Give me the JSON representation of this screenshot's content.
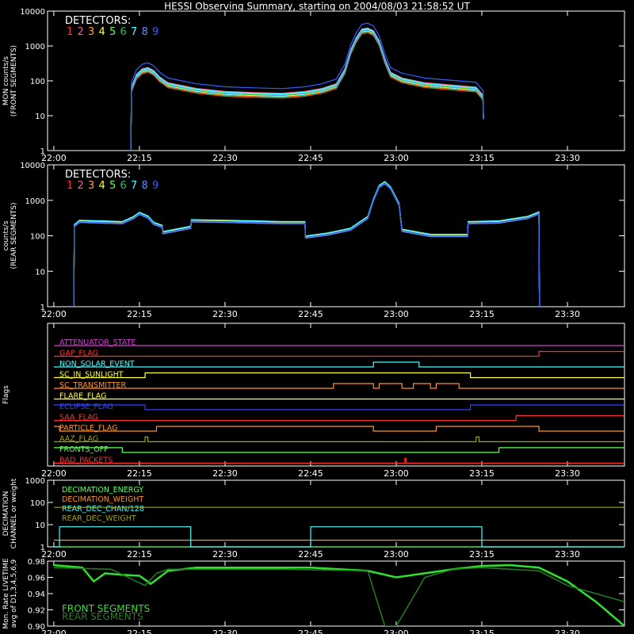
{
  "title": "HESSI Observing Summary, starting on 2004/08/03 21:58:52 UT",
  "time_labels": [
    "22:00",
    "22:15",
    "22:30",
    "22:45",
    "23:00",
    "23:15",
    "23:30"
  ],
  "colors": {
    "det": [
      "#ff3030",
      "#ff5aa0",
      "#ffa030",
      "#ffff40",
      "#60ff60",
      "#30c060",
      "#40ffff",
      "#6090ff",
      "#3060ff"
    ],
    "axis": "#ffffff",
    "background": "#000000"
  },
  "chart_data": [
    {
      "type": "line",
      "panel": "front",
      "ylabel": "MON counts/s (FRONT SEGMENTS)",
      "yscale": "log",
      "ylim": [
        1,
        10000
      ],
      "ytick_labels": [
        "1",
        "10",
        "100",
        "1000",
        "10000"
      ],
      "legend_title": "DETECTORS:",
      "legend_labels": [
        "1",
        "2",
        "3",
        "4",
        "5",
        "6",
        "7",
        "8",
        "9"
      ],
      "x_minutes": [
        13.5,
        13.6,
        14.5,
        15.5,
        16.5,
        17.5,
        18.5,
        20,
        25,
        30,
        35,
        40,
        44,
        47,
        49.5,
        51,
        52,
        53,
        54,
        55,
        56,
        57,
        58,
        59,
        61,
        65,
        74,
        75.2,
        75.3
      ],
      "y": [
        1,
        60,
        140,
        200,
        220,
        180,
        120,
        80,
        55,
        45,
        42,
        40,
        45,
        55,
        75,
        200,
        700,
        1600,
        2800,
        3000,
        2500,
        1300,
        400,
        160,
        110,
        80,
        60,
        35,
        8
      ],
      "detector_scale": [
        0.8,
        1.1,
        1.0,
        0.9,
        1.0,
        0.85,
        1.05,
        0.95,
        1.5
      ]
    },
    {
      "type": "line",
      "panel": "rear",
      "ylabel": "counts/s (REAR SEGMENTS)",
      "yscale": "log",
      "ylim": [
        1,
        10000
      ],
      "ytick_labels": [
        "1",
        "10",
        "100",
        "1000",
        "10000"
      ],
      "legend_title": "DETECTORS:",
      "legend_labels": [
        "1",
        "2",
        "3",
        "4",
        "5",
        "6",
        "7",
        "8",
        "9"
      ],
      "x_minutes": [
        3.5,
        3.6,
        4.5,
        8,
        12,
        14,
        15,
        16.5,
        17.5,
        19,
        19.1,
        24,
        24.1,
        30,
        35,
        40,
        44,
        44.1,
        48,
        52,
        55,
        56,
        57,
        58,
        59,
        60.5,
        61,
        66,
        72.5,
        72.6,
        78,
        83,
        85,
        85.1
      ],
      "y": [
        1,
        190,
        250,
        240,
        230,
        320,
        420,
        330,
        220,
        180,
        120,
        170,
        260,
        250,
        240,
        230,
        230,
        90,
        110,
        150,
        320,
        1000,
        2400,
        3100,
        2200,
        750,
        140,
        100,
        100,
        230,
        240,
        320,
        430,
        1
      ],
      "detector_scale": [
        1.0,
        1.0,
        0.95,
        1.05,
        1.0,
        1.0,
        1.1,
        0.95,
        1.0
      ]
    },
    {
      "type": "step",
      "panel": "flags",
      "ylabel": "Flags",
      "series": [
        {
          "name": "ATTENUATOR_STATE",
          "color": "#d040d0",
          "x": [
            0,
            100
          ],
          "y": [
            0,
            0
          ]
        },
        {
          "name": "GAP_FLAG",
          "color": "#ff3030",
          "x": [
            0,
            85,
            85,
            100
          ],
          "y": [
            0,
            0,
            1,
            1
          ]
        },
        {
          "name": "NON_SOLAR_EVENT",
          "color": "#40ffff",
          "x": [
            0,
            56,
            56,
            64,
            64,
            100
          ],
          "y": [
            0,
            0,
            1,
            1,
            0,
            0
          ]
        },
        {
          "name": "SC_IN_SUNLIGHT",
          "color": "#ffff40",
          "x": [
            0,
            16,
            16,
            73,
            73,
            100
          ],
          "y": [
            0,
            0,
            1,
            1,
            0,
            0
          ]
        },
        {
          "name": "SC_TRANSMITTER",
          "color": "#ff9030",
          "x": [
            0,
            49,
            49,
            56,
            56,
            57,
            57,
            61,
            61,
            63,
            63,
            66,
            66,
            67,
            67,
            71,
            71,
            100
          ],
          "y": [
            0,
            0,
            1,
            1,
            0,
            0,
            1,
            1,
            0,
            0,
            1,
            1,
            0,
            0,
            1,
            1,
            0,
            0
          ]
        },
        {
          "name": "FLARE_FLAG",
          "color": "#ffff40",
          "x": [
            0,
            100
          ],
          "y": [
            0,
            0
          ]
        },
        {
          "name": "ECLIPSE_FLAG",
          "color": "#3040ff",
          "x": [
            0,
            16,
            16,
            73,
            73,
            100
          ],
          "y": [
            1,
            1,
            0,
            0,
            1,
            1
          ]
        },
        {
          "name": "SAA_FLAG",
          "color": "#ff3030",
          "x": [
            0,
            81,
            81,
            100
          ],
          "y": [
            0,
            0,
            1,
            1
          ]
        },
        {
          "name": "PARTICLE_FLAG",
          "color": "#ff9030",
          "x": [
            0,
            1,
            1,
            18,
            18,
            56,
            56,
            67,
            67,
            85,
            85,
            100
          ],
          "y": [
            1,
            1,
            0,
            0,
            1,
            1,
            0,
            0,
            1,
            1,
            0,
            0
          ]
        },
        {
          "name": "AAZ_FLAG",
          "color": "#a0a020",
          "x": [
            0,
            16,
            16,
            16.5,
            16.5,
            74,
            74,
            74.5,
            74.5,
            100
          ],
          "y": [
            0,
            0,
            1,
            1,
            0,
            0,
            1,
            1,
            0,
            0
          ]
        },
        {
          "name": "FRONTS_OFF",
          "color": "#60ff60",
          "x": [
            0,
            12,
            12,
            78,
            78,
            100
          ],
          "y": [
            1,
            1,
            0,
            0,
            1,
            1
          ]
        },
        {
          "name": "BAD_PACKETS",
          "color": "#ff3030",
          "x": [
            0,
            61.5,
            61.5,
            61.7,
            61.7,
            100
          ],
          "y": [
            0,
            0,
            1,
            1,
            0,
            0
          ]
        }
      ]
    },
    {
      "type": "step",
      "panel": "decimation",
      "ylabel": "DECIMATION CHANNEL or weight",
      "yscale": "log",
      "ylim": [
        1,
        1000
      ],
      "ytick_labels": [
        "1",
        "10",
        "100",
        "1000"
      ],
      "series": [
        {
          "name": "DECIMATION_ENERGY",
          "color": "#60ff60",
          "x": [
            0,
            100
          ],
          "y": [
            1,
            1
          ]
        },
        {
          "name": "DECIMATION_WEIGHT",
          "color": "#ff9030",
          "x": [
            0,
            100
          ],
          "y": [
            2,
            2
          ]
        },
        {
          "name": "REAR_DEC_CHAN/128",
          "color": "#40ffff",
          "x": [
            0,
            1,
            1,
            24,
            24,
            45,
            45,
            75,
            75,
            100
          ],
          "y": [
            1,
            1,
            8,
            8,
            1,
            1,
            8,
            8,
            1,
            1
          ]
        },
        {
          "name": "REAR_DEC_WEIGHT",
          "color": "#a0a020",
          "x": [
            0,
            100
          ],
          "y": [
            60,
            60
          ]
        }
      ]
    },
    {
      "type": "line",
      "panel": "livetime",
      "ylabel": "Mon. Rate LIVETIME avg of D1,3,4,5,6,9",
      "ylim": [
        0.9,
        0.98
      ],
      "ytick_labels": [
        "0.90",
        "0.92",
        "0.94",
        "0.96",
        "0.98"
      ],
      "series": [
        {
          "name": "FRONT SEGMENTS",
          "color": "#30e030",
          "x": [
            0,
            5,
            7,
            9,
            12,
            15,
            17,
            20,
            25,
            45,
            55,
            60,
            65,
            70,
            75,
            80,
            85,
            90,
            95,
            100
          ],
          "y": [
            0.975,
            0.972,
            0.955,
            0.965,
            0.963,
            0.962,
            0.952,
            0.968,
            0.972,
            0.972,
            0.968,
            0.96,
            0.965,
            0.97,
            0.974,
            0.975,
            0.972,
            0.955,
            0.93,
            0.9
          ]
        },
        {
          "name": "REAR SEGMENTS",
          "color": "#208020",
          "x": [
            0,
            10,
            13,
            16,
            18,
            20,
            40,
            55,
            58,
            60,
            65,
            70,
            75,
            80,
            85,
            90,
            100
          ],
          "y": [
            0.972,
            0.97,
            0.96,
            0.95,
            0.965,
            0.97,
            0.97,
            0.968,
            0.9,
            0.9,
            0.96,
            0.97,
            0.972,
            0.97,
            0.968,
            0.95,
            0.93
          ]
        }
      ],
      "dropouts": [
        {
          "from": 59,
          "to": 66,
          "value": 0.9
        }
      ]
    }
  ]
}
